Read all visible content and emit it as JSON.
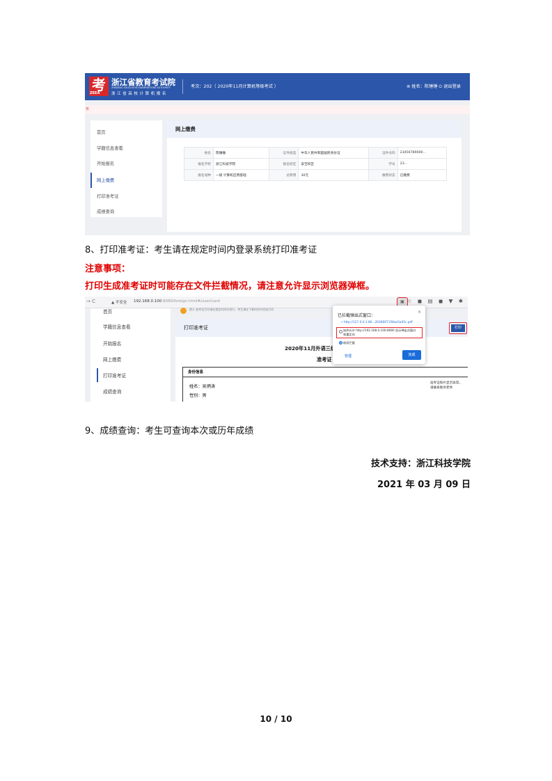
{
  "screenshot1": {
    "logo_char": "考",
    "logo_small": "ZEEA",
    "org_name": "浙江省教育考试院",
    "org_name_en": "ZHEJIANG EDUCATION EXAMINATIONS AUTHORITY",
    "system_name": "浙江省高校计算机报名",
    "exam_info": "考次：202（ 2020年11月计算机等级考试 ）",
    "user_info": "⊚ 姓名：陈锤锤   ⏻ 退出登录",
    "notice_char": "务",
    "sidebar": [
      "首页",
      "学籍信息查看",
      "开始报名",
      "网上缴费",
      "打印准考证",
      "成绩查询"
    ],
    "page_title": "网上缴费",
    "table": [
      [
        {
          "label": "姓名",
          "value": "陈锤锤"
        },
        {
          "label": "证件类型",
          "value": "中华人民共和国居民身份证"
        },
        {
          "label": "证件号码",
          "value": "23456789000..."
        }
      ],
      [
        {
          "label": "报名学校",
          "value": "浙江科技学院"
        },
        {
          "label": "报名校区",
          "value": "安吉校区"
        },
        {
          "label": "学号",
          "value": "23..."
        }
      ],
      [
        {
          "label": "报名语种",
          "value": "一级 计算机应用基础"
        },
        {
          "label": "总费用",
          "value": "30元"
        },
        {
          "label": "缴费状态",
          "value": "已缴费"
        }
      ]
    ]
  },
  "para8": "8、打印准考证：考生请在规定时间内登录系统打印准考证",
  "note_title": "注意事项：",
  "note_body": "打印生成准考证时可能存在文件拦截情况，请注意允许显示浏览器弹框。",
  "screenshot2": {
    "nav": "→  C",
    "insecure": "▲ 不安全",
    "url_host": "192.168.0.100",
    "url_rest": ":8080/foreign.html#/user/card",
    "toolbar_icons": "☆ ◼ ▤ ◼ ▼ ✱",
    "block_icon": "▣",
    "msg_text": "提示 准考证打印请在规定时间内进行，考生请在下载时间内完成打印",
    "sidebar": [
      "首页",
      "学籍信息查看",
      "开始报名",
      "网上缴费",
      "打印准考证",
      "成绩查询"
    ],
    "page_title": "打印准考证",
    "print_button": "打印",
    "doc_title": "2020年11月外语三级",
    "doc_subtitle": "准考证",
    "section_title": "身份信息",
    "name_line": "姓名：吴炳涛",
    "gender_line": "性别：男",
    "photo_text": "准考证照片显示异常，请联系教务老师",
    "popup": {
      "title": "已拦截弹出式窗口：",
      "close": "×",
      "link": "• http://127.0.0.1:80...2036667158ae5a45c.pdf",
      "option1": "始终允许 http://192.168.0.100:8080 显示弹出式窗口和重定向",
      "option2": "继续拦截",
      "manage": "管理",
      "done": "完成"
    }
  },
  "para9": "9、成绩查询：考生可查询本次或历年成绩",
  "support": "技术支持：浙江科技学院",
  "date": "2021 年 03 月 09 日",
  "page_number": "10 / 10"
}
